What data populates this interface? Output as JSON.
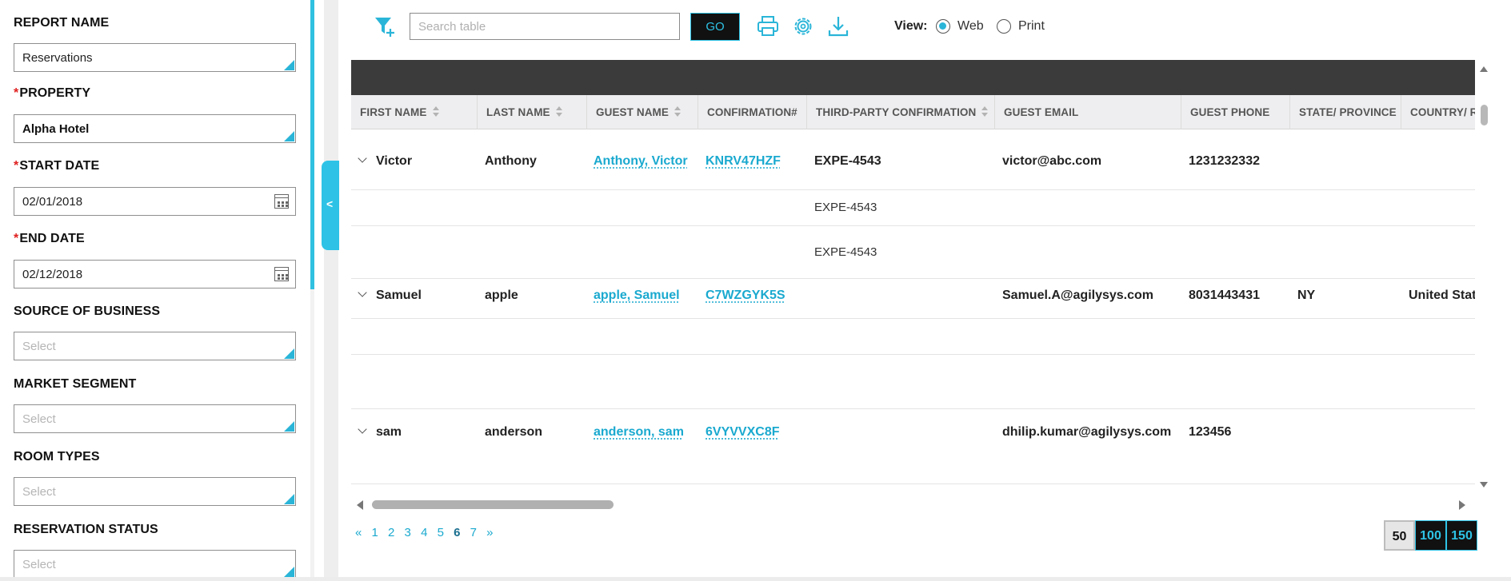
{
  "filters": {
    "report_name": {
      "label": "REPORT NAME",
      "value": "Reservations"
    },
    "property": {
      "required": "*",
      "label": "PROPERTY",
      "value": "Alpha Hotel"
    },
    "start_date": {
      "required": "*",
      "label": "START DATE",
      "value": "02/01/2018"
    },
    "end_date": {
      "required": "*",
      "label": "END DATE",
      "value": "02/12/2018"
    },
    "source_of_business": {
      "label": "SOURCE OF BUSINESS",
      "placeholder": "Select"
    },
    "market_segment": {
      "label": "MARKET SEGMENT",
      "placeholder": "Select"
    },
    "room_types": {
      "label": "ROOM TYPES",
      "placeholder": "Select"
    },
    "reservation_status": {
      "label": "RESERVATION STATUS",
      "placeholder": "Select"
    }
  },
  "collapse_glyph": "<",
  "toolbar": {
    "search_placeholder": "Search table",
    "go_label": "GO",
    "view_label": "View:",
    "view_options": [
      "Web",
      "Print"
    ],
    "view_selected": "Web",
    "icons": [
      "filter-add-icon",
      "print-icon",
      "gear-icon",
      "download-icon"
    ],
    "accent_color": "#2ec3e6"
  },
  "table": {
    "columns": [
      "FIRST NAME",
      "LAST NAME",
      "GUEST NAME",
      "CONFIRMATION#",
      "THIRD-PARTY CONFIRMATION",
      "GUEST EMAIL",
      "GUEST PHONE",
      "STATE/ PROVINCE",
      "COUNTRY/ R"
    ],
    "rows": [
      {
        "first_name": "Victor",
        "last_name": "Anthony",
        "guest_name": "Anthony, Victor",
        "confirmation": "KNRV47HZF",
        "third_party": "EXPE-4543",
        "email": "victor@abc.com",
        "phone": "1231232332",
        "state": "",
        "country": "",
        "sub_rows": [
          "EXPE-4543",
          "EXPE-4543"
        ]
      },
      {
        "first_name": "Samuel",
        "last_name": "apple",
        "guest_name": "apple, Samuel",
        "confirmation": "C7WZGYK5S",
        "third_party": "",
        "email": "Samuel.A@agilysys.com",
        "phone": "8031443431",
        "state": "NY",
        "country": "United State"
      },
      {
        "first_name": "sam",
        "last_name": "anderson",
        "guest_name": "anderson, sam",
        "confirmation": "6VYVVXC8F",
        "third_party": "",
        "email": "dhilip.kumar@agilysys.com",
        "phone": "123456",
        "state": "",
        "country": ""
      }
    ]
  },
  "pagination": {
    "prev": "«",
    "next": "»",
    "pages": [
      "1",
      "2",
      "3",
      "4",
      "5",
      "6",
      "7"
    ],
    "current": "6",
    "page_sizes": [
      "50",
      "100",
      "150"
    ],
    "selected_page_size": "50"
  }
}
